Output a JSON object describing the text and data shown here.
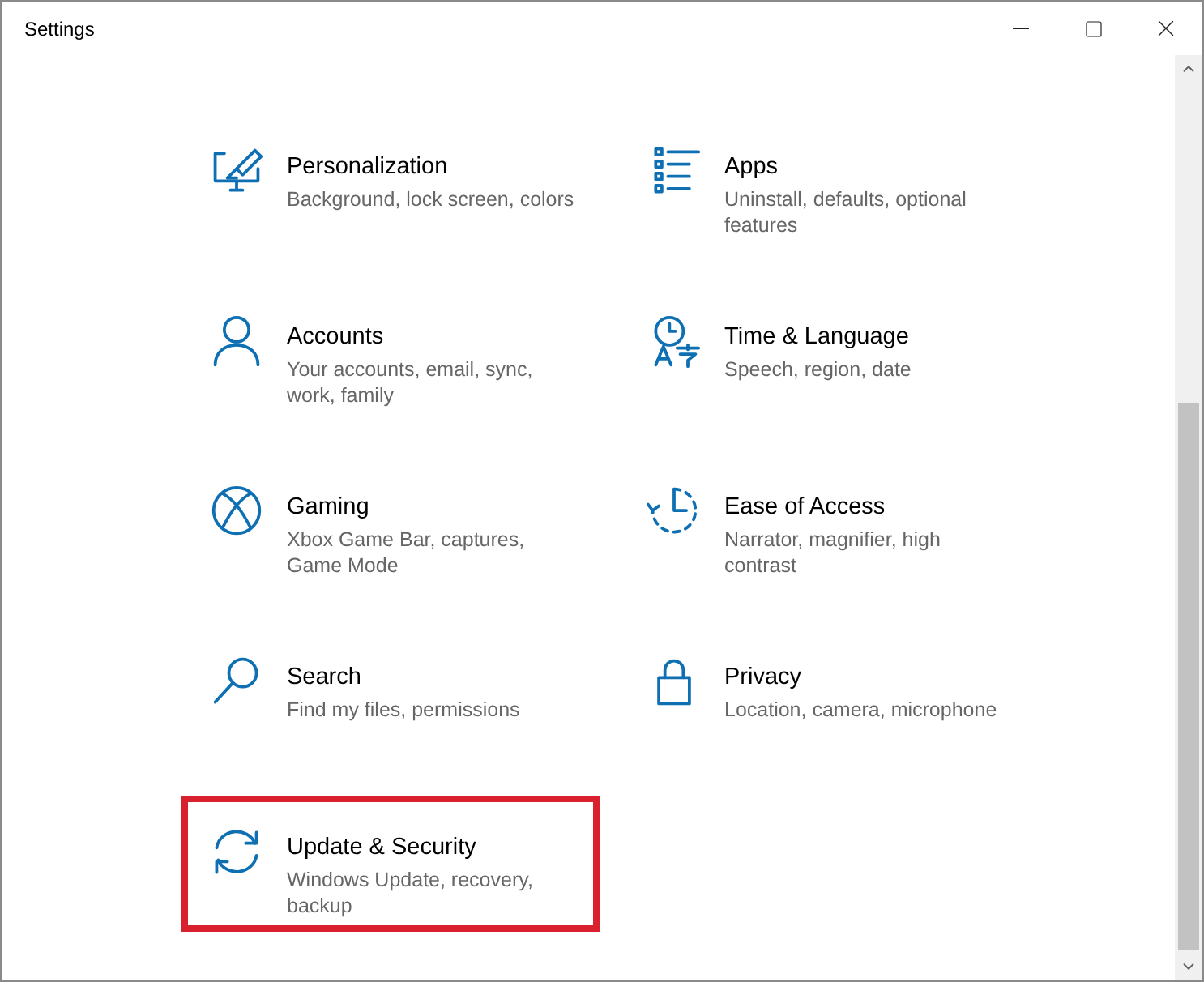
{
  "window": {
    "title": "Settings"
  },
  "categories": [
    {
      "title": "Personalization",
      "description": "Background, lock screen, colors",
      "highlighted": false
    },
    {
      "title": "Apps",
      "description": "Uninstall, defaults, optional features",
      "highlighted": false
    },
    {
      "title": "Accounts",
      "description": "Your accounts, email, sync, work, family",
      "highlighted": false
    },
    {
      "title": "Time & Language",
      "description": "Speech, region, date",
      "highlighted": false
    },
    {
      "title": "Gaming",
      "description": "Xbox Game Bar, captures, Game Mode",
      "highlighted": false
    },
    {
      "title": "Ease of Access",
      "description": "Narrator, magnifier, high contrast",
      "highlighted": false
    },
    {
      "title": "Search",
      "description": "Find my files, permissions",
      "highlighted": false
    },
    {
      "title": "Privacy",
      "description": "Location, camera, microphone",
      "highlighted": false
    },
    {
      "title": "Update & Security",
      "description": "Windows Update, recovery, backup",
      "highlighted": true
    }
  ]
}
